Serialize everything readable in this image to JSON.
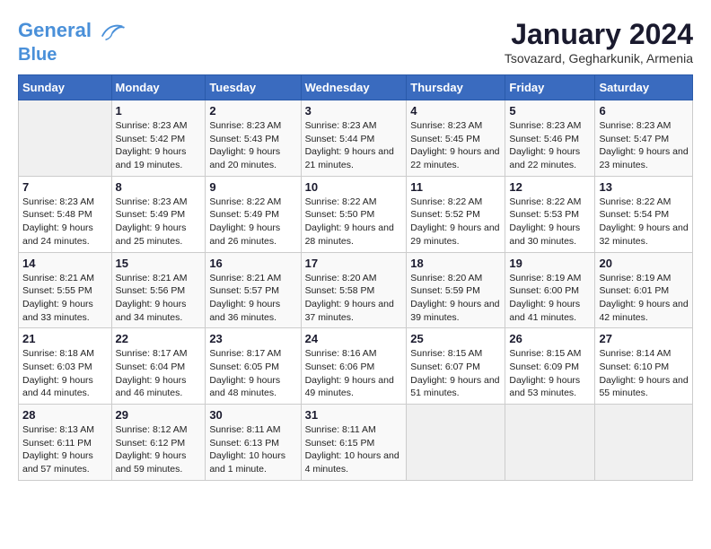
{
  "header": {
    "logo_line1": "General",
    "logo_line2": "Blue",
    "month_title": "January 2024",
    "location": "Tsovazard, Gegharkunik, Armenia"
  },
  "weekdays": [
    "Sunday",
    "Monday",
    "Tuesday",
    "Wednesday",
    "Thursday",
    "Friday",
    "Saturday"
  ],
  "weeks": [
    [
      {
        "day": "",
        "sunrise": "",
        "sunset": "",
        "daylight": ""
      },
      {
        "day": "1",
        "sunrise": "8:23 AM",
        "sunset": "5:42 PM",
        "daylight": "9 hours and 19 minutes."
      },
      {
        "day": "2",
        "sunrise": "8:23 AM",
        "sunset": "5:43 PM",
        "daylight": "9 hours and 20 minutes."
      },
      {
        "day": "3",
        "sunrise": "8:23 AM",
        "sunset": "5:44 PM",
        "daylight": "9 hours and 21 minutes."
      },
      {
        "day": "4",
        "sunrise": "8:23 AM",
        "sunset": "5:45 PM",
        "daylight": "9 hours and 22 minutes."
      },
      {
        "day": "5",
        "sunrise": "8:23 AM",
        "sunset": "5:46 PM",
        "daylight": "9 hours and 22 minutes."
      },
      {
        "day": "6",
        "sunrise": "8:23 AM",
        "sunset": "5:47 PM",
        "daylight": "9 hours and 23 minutes."
      }
    ],
    [
      {
        "day": "7",
        "sunrise": "8:23 AM",
        "sunset": "5:48 PM",
        "daylight": "9 hours and 24 minutes."
      },
      {
        "day": "8",
        "sunrise": "8:23 AM",
        "sunset": "5:49 PM",
        "daylight": "9 hours and 25 minutes."
      },
      {
        "day": "9",
        "sunrise": "8:22 AM",
        "sunset": "5:49 PM",
        "daylight": "9 hours and 26 minutes."
      },
      {
        "day": "10",
        "sunrise": "8:22 AM",
        "sunset": "5:50 PM",
        "daylight": "9 hours and 28 minutes."
      },
      {
        "day": "11",
        "sunrise": "8:22 AM",
        "sunset": "5:52 PM",
        "daylight": "9 hours and 29 minutes."
      },
      {
        "day": "12",
        "sunrise": "8:22 AM",
        "sunset": "5:53 PM",
        "daylight": "9 hours and 30 minutes."
      },
      {
        "day": "13",
        "sunrise": "8:22 AM",
        "sunset": "5:54 PM",
        "daylight": "9 hours and 32 minutes."
      }
    ],
    [
      {
        "day": "14",
        "sunrise": "8:21 AM",
        "sunset": "5:55 PM",
        "daylight": "9 hours and 33 minutes."
      },
      {
        "day": "15",
        "sunrise": "8:21 AM",
        "sunset": "5:56 PM",
        "daylight": "9 hours and 34 minutes."
      },
      {
        "day": "16",
        "sunrise": "8:21 AM",
        "sunset": "5:57 PM",
        "daylight": "9 hours and 36 minutes."
      },
      {
        "day": "17",
        "sunrise": "8:20 AM",
        "sunset": "5:58 PM",
        "daylight": "9 hours and 37 minutes."
      },
      {
        "day": "18",
        "sunrise": "8:20 AM",
        "sunset": "5:59 PM",
        "daylight": "9 hours and 39 minutes."
      },
      {
        "day": "19",
        "sunrise": "8:19 AM",
        "sunset": "6:00 PM",
        "daylight": "9 hours and 41 minutes."
      },
      {
        "day": "20",
        "sunrise": "8:19 AM",
        "sunset": "6:01 PM",
        "daylight": "9 hours and 42 minutes."
      }
    ],
    [
      {
        "day": "21",
        "sunrise": "8:18 AM",
        "sunset": "6:03 PM",
        "daylight": "9 hours and 44 minutes."
      },
      {
        "day": "22",
        "sunrise": "8:17 AM",
        "sunset": "6:04 PM",
        "daylight": "9 hours and 46 minutes."
      },
      {
        "day": "23",
        "sunrise": "8:17 AM",
        "sunset": "6:05 PM",
        "daylight": "9 hours and 48 minutes."
      },
      {
        "day": "24",
        "sunrise": "8:16 AM",
        "sunset": "6:06 PM",
        "daylight": "9 hours and 49 minutes."
      },
      {
        "day": "25",
        "sunrise": "8:15 AM",
        "sunset": "6:07 PM",
        "daylight": "9 hours and 51 minutes."
      },
      {
        "day": "26",
        "sunrise": "8:15 AM",
        "sunset": "6:09 PM",
        "daylight": "9 hours and 53 minutes."
      },
      {
        "day": "27",
        "sunrise": "8:14 AM",
        "sunset": "6:10 PM",
        "daylight": "9 hours and 55 minutes."
      }
    ],
    [
      {
        "day": "28",
        "sunrise": "8:13 AM",
        "sunset": "6:11 PM",
        "daylight": "9 hours and 57 minutes."
      },
      {
        "day": "29",
        "sunrise": "8:12 AM",
        "sunset": "6:12 PM",
        "daylight": "9 hours and 59 minutes."
      },
      {
        "day": "30",
        "sunrise": "8:11 AM",
        "sunset": "6:13 PM",
        "daylight": "10 hours and 1 minute."
      },
      {
        "day": "31",
        "sunrise": "8:11 AM",
        "sunset": "6:15 PM",
        "daylight": "10 hours and 4 minutes."
      },
      {
        "day": "",
        "sunrise": "",
        "sunset": "",
        "daylight": ""
      },
      {
        "day": "",
        "sunrise": "",
        "sunset": "",
        "daylight": ""
      },
      {
        "day": "",
        "sunrise": "",
        "sunset": "",
        "daylight": ""
      }
    ]
  ]
}
